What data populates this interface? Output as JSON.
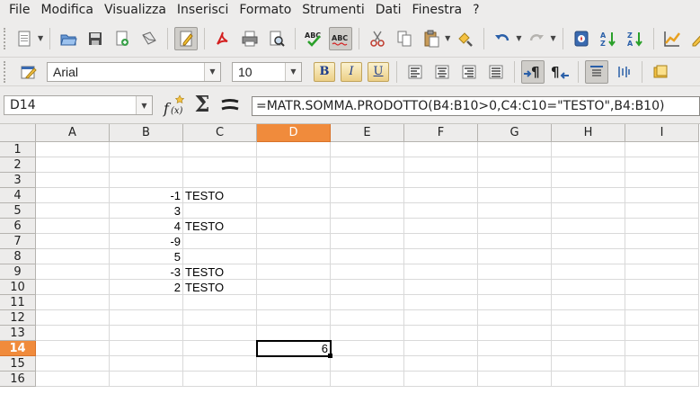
{
  "menu": {
    "items": [
      "File",
      "Modifica",
      "Visualizza",
      "Inserisci",
      "Formato",
      "Strumenti",
      "Dati",
      "Finestra",
      "?"
    ]
  },
  "toolbar_standard": {
    "icons": [
      "new-document-icon",
      "open-folder-icon",
      "save-icon",
      "email-document-icon",
      "edit-mode-icon",
      "export-pdf-icon",
      "print-icon",
      "page-preview-icon",
      "spellcheck-icon",
      "autospellcheck-icon",
      "cut-icon",
      "copy-icon",
      "paste-icon",
      "format-paintbrush-icon",
      "undo-icon",
      "redo-icon",
      "navigator-icon",
      "sort-ascending-icon",
      "sort-descending-icon",
      "chart-icon",
      "draw-functions-icon"
    ]
  },
  "toolbar_format": {
    "font_name": "Arial",
    "font_size": "10",
    "bold_label": "B",
    "italic_label": "I",
    "underline_label": "U"
  },
  "formula_bar": {
    "name_box": "D14",
    "formula": "=MATR.SOMMA.PRODOTTO(B4:B10>0,C4:C10=\"TESTO\",B4:B10)"
  },
  "sheet": {
    "columns": [
      "A",
      "B",
      "C",
      "D",
      "E",
      "F",
      "G",
      "H",
      "I"
    ],
    "rows": [
      "1",
      "2",
      "3",
      "4",
      "5",
      "6",
      "7",
      "8",
      "9",
      "10",
      "11",
      "12",
      "13",
      "14",
      "15",
      "16"
    ],
    "selected_column": "D",
    "selected_row": "14",
    "cells": [
      {
        "ref": "B4",
        "value": "-1"
      },
      {
        "ref": "C4",
        "value": "TESTO"
      },
      {
        "ref": "B5",
        "value": "3"
      },
      {
        "ref": "B6",
        "value": "4"
      },
      {
        "ref": "C6",
        "value": "TESTO"
      },
      {
        "ref": "B7",
        "value": "-9"
      },
      {
        "ref": "B8",
        "value": "5"
      },
      {
        "ref": "B9",
        "value": "-3"
      },
      {
        "ref": "C9",
        "value": "TESTO"
      },
      {
        "ref": "B10",
        "value": "2"
      },
      {
        "ref": "C10",
        "value": "TESTO"
      },
      {
        "ref": "D14",
        "value": "6"
      }
    ]
  },
  "colors": {
    "selection_header": "#f08b3c",
    "grid_line": "#d9d9d9",
    "toolbar_bg": "#edeceb"
  }
}
